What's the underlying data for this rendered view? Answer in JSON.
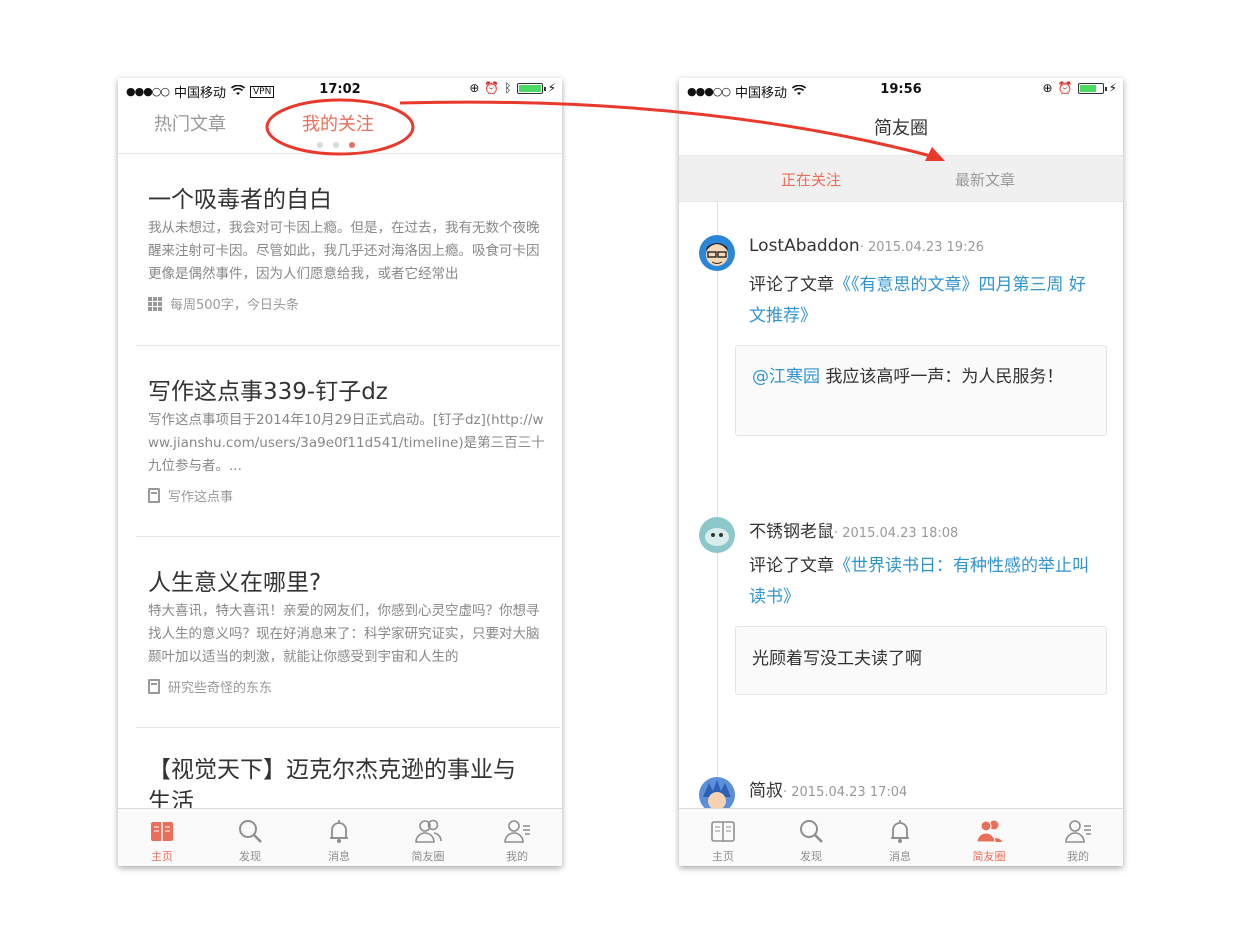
{
  "left_phone": {
    "status": {
      "signal": "●●●○○",
      "carrier": "中国移动",
      "vpn": "VPN",
      "time": "17:02",
      "battery_fill": 1.0
    },
    "tabs": {
      "hot": "热门文章",
      "following": "我的关注",
      "pager_count": 3,
      "pager_active": 3
    },
    "articles": [
      {
        "title": "一个吸毒者的自白",
        "excerpt": "我从未想过，我会对可卡因上瘾。但是，在过去，我有无数个夜晚醒来注射可卡因。尽管如此，我几乎还对海洛因上瘾。吸食可卡因更像是偶然事件，因为人们愿意给我，或者它经常出",
        "meta": "每周500字，今日头条",
        "meta_icon": "grid-icon"
      },
      {
        "title": "写作这点事339-钉子dz",
        "excerpt": "写作这点事项目于2014年10月29日正式启动。[钉子dz](http://www.jianshu.com/users/3a9e0f11d541/timeline)是第三百三十九位参与者。...",
        "meta": "写作这点事",
        "meta_icon": "book-icon"
      },
      {
        "title": "人生意义在哪里?",
        "excerpt": "特大喜讯，特大喜讯！亲爱的网友们，你感到心灵空虚吗？你想寻找人生的意义吗？现在好消息来了：科学家研究证实，只要对大脑颞叶加以适当的刺激，就能让你感受到宇宙和人生的",
        "meta": "研究些奇怪的东东",
        "meta_icon": "book-icon"
      },
      {
        "title": "【视觉天下】迈克尔杰克逊的事业与生活",
        "excerpt": "",
        "meta": "",
        "meta_icon": ""
      }
    ],
    "tabbar": [
      {
        "label": "主页",
        "icon": "home-book-icon",
        "active": true
      },
      {
        "label": "发现",
        "icon": "search-icon",
        "active": false
      },
      {
        "label": "消息",
        "icon": "bell-icon",
        "active": false
      },
      {
        "label": "简友圈",
        "icon": "friends-icon",
        "active": false
      },
      {
        "label": "我的",
        "icon": "profile-icon",
        "active": false
      }
    ]
  },
  "right_phone": {
    "status": {
      "signal": "●●●○○",
      "carrier": "中国移动",
      "time": "19:56",
      "battery_fill": 0.75
    },
    "title": "简友圈",
    "segments": {
      "following": "正在关注",
      "latest": "最新文章"
    },
    "feed": [
      {
        "user": "LostAbaddon",
        "time": "· 2015.04.23 19:26",
        "action": "评论了文章",
        "article": "《《有意思的文章》四月第三周 好文推荐》",
        "quote_at": "@江寒园",
        "quote": " 我应该高呼一声：为人民服务！"
      },
      {
        "user": "不锈钢老鼠",
        "time": "· 2015.04.23 18:08",
        "action": "评论了文章",
        "article": "《世界读书日：有种性感的举止叫读书》",
        "quote_at": "",
        "quote": "光顾着写没工夫读了啊"
      },
      {
        "user": "简叔",
        "time": "· 2015.04.23 17:04",
        "action": "",
        "article": "",
        "quote_at": "",
        "quote": ""
      }
    ],
    "tabbar": [
      {
        "label": "主页",
        "icon": "home-book-icon",
        "active": false
      },
      {
        "label": "发现",
        "icon": "search-icon",
        "active": false
      },
      {
        "label": "消息",
        "icon": "bell-icon",
        "active": false
      },
      {
        "label": "简友圈",
        "icon": "friends-icon",
        "active": true
      },
      {
        "label": "我的",
        "icon": "profile-icon",
        "active": false
      }
    ]
  },
  "colors": {
    "accent": "#ea6f5a",
    "link": "#3194d0",
    "annotation": "#e8392c"
  }
}
